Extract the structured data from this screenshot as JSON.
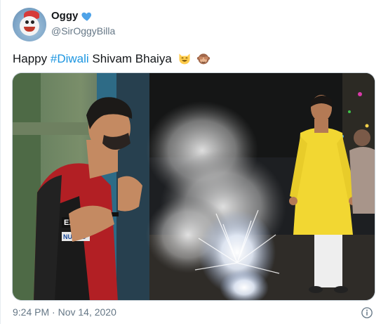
{
  "tweet": {
    "display_name": "Oggy",
    "handle": "@SirOggyBilla",
    "text_before": "Happy ",
    "hashtag": "#Diwali",
    "text_after": " Shivam Bhaiya",
    "emojis": [
      "smiling-cat-icon",
      "see-no-evil-monkey-icon"
    ],
    "timestamp": "9:24 PM · Nov 14, 2020",
    "media": {
      "left_image": "cricketer-leaning-on-pole",
      "right_image": "man-in-yellow-kurta-with-fireworks",
      "jersey_text_1": "EXIDE",
      "jersey_text_2": "NUVOC"
    }
  },
  "colors": {
    "accent": "#1b95e0",
    "text": "#14171a",
    "secondary": "#657786",
    "verified_badge": "#4fa3e8"
  }
}
